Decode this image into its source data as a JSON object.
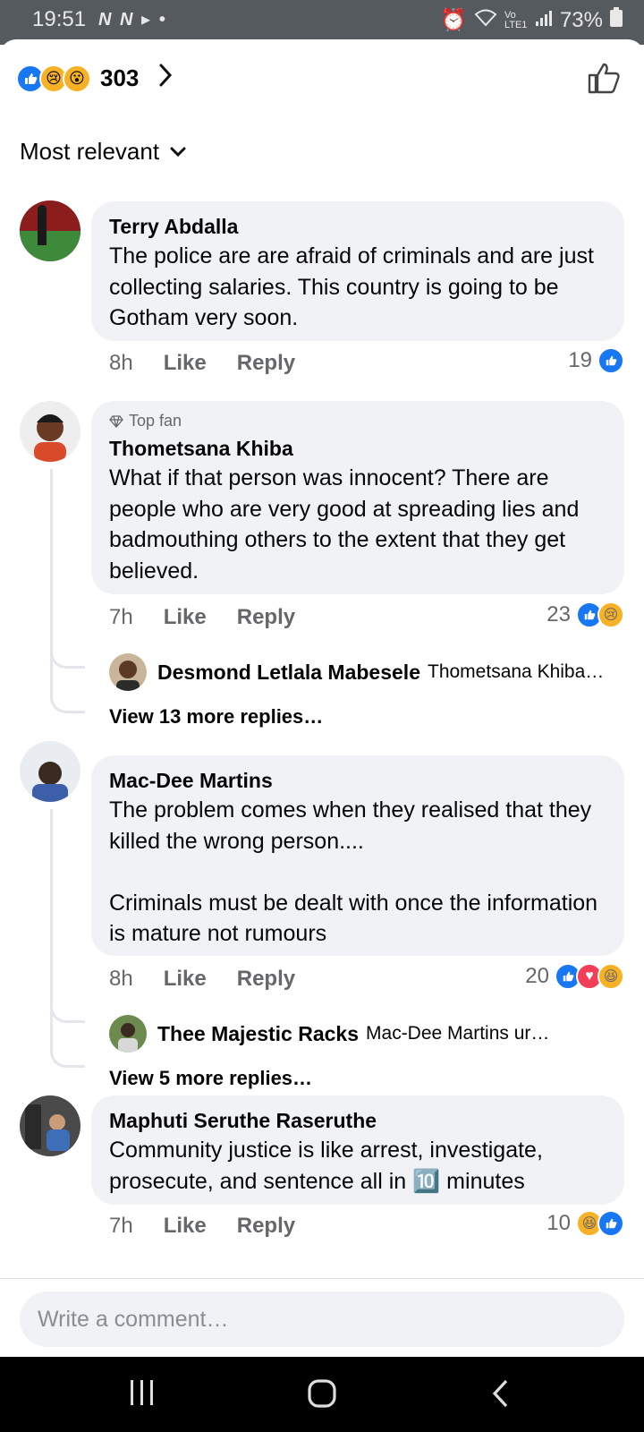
{
  "status_bar": {
    "time": "19:51",
    "left_icons": "N N ▸ •",
    "battery": "73%",
    "network": "Vo LTE1"
  },
  "reactions": {
    "count": "303"
  },
  "sort": {
    "label": "Most relevant"
  },
  "comments": [
    {
      "author": "Terry Abdalla",
      "badge": "",
      "text": "The police are are afraid of criminals and are just collecting salaries. This country is going to be Gotham  very soon.",
      "time": "8h",
      "like": "Like",
      "reply": "Reply",
      "reaction_count": "19"
    },
    {
      "author": "Thometsana Khiba",
      "badge": "Top fan",
      "text": "What if that person was innocent? There are people who are very good at spreading lies and badmouthing others to the extent that they get believed.",
      "time": "7h",
      "like": "Like",
      "reply": "Reply",
      "reaction_count": "23",
      "reply_preview": {
        "author": "Desmond Letlala Mabesele",
        "text": "Thometsana Khiba…"
      },
      "view_more": "View 13 more replies…"
    },
    {
      "author": "Mac-Dee Martins",
      "badge": "",
      "text": "The problem comes when they realised that they killed the wrong person....\n\nCriminals must be dealt with once the information is mature not rumours",
      "time": "8h",
      "like": "Like",
      "reply": "Reply",
      "reaction_count": "20",
      "reply_preview": {
        "author": "Thee Majestic Racks",
        "text": "Mac-Dee Martins  ur not i…"
      },
      "view_more": "View 5 more replies…"
    },
    {
      "author": "Maphuti Seruthe Raseruthe",
      "badge": "",
      "text": "Community justice is like arrest, investigate, prosecute, and sentence all in 🔟 minutes",
      "time": "7h",
      "like": "Like",
      "reply": "Reply",
      "reaction_count": "10"
    }
  ],
  "composer": {
    "placeholder": "Write a comment…"
  },
  "colors": {
    "accent": "#1877f2",
    "bubble": "#f0f2f5",
    "muted": "#65676b"
  }
}
